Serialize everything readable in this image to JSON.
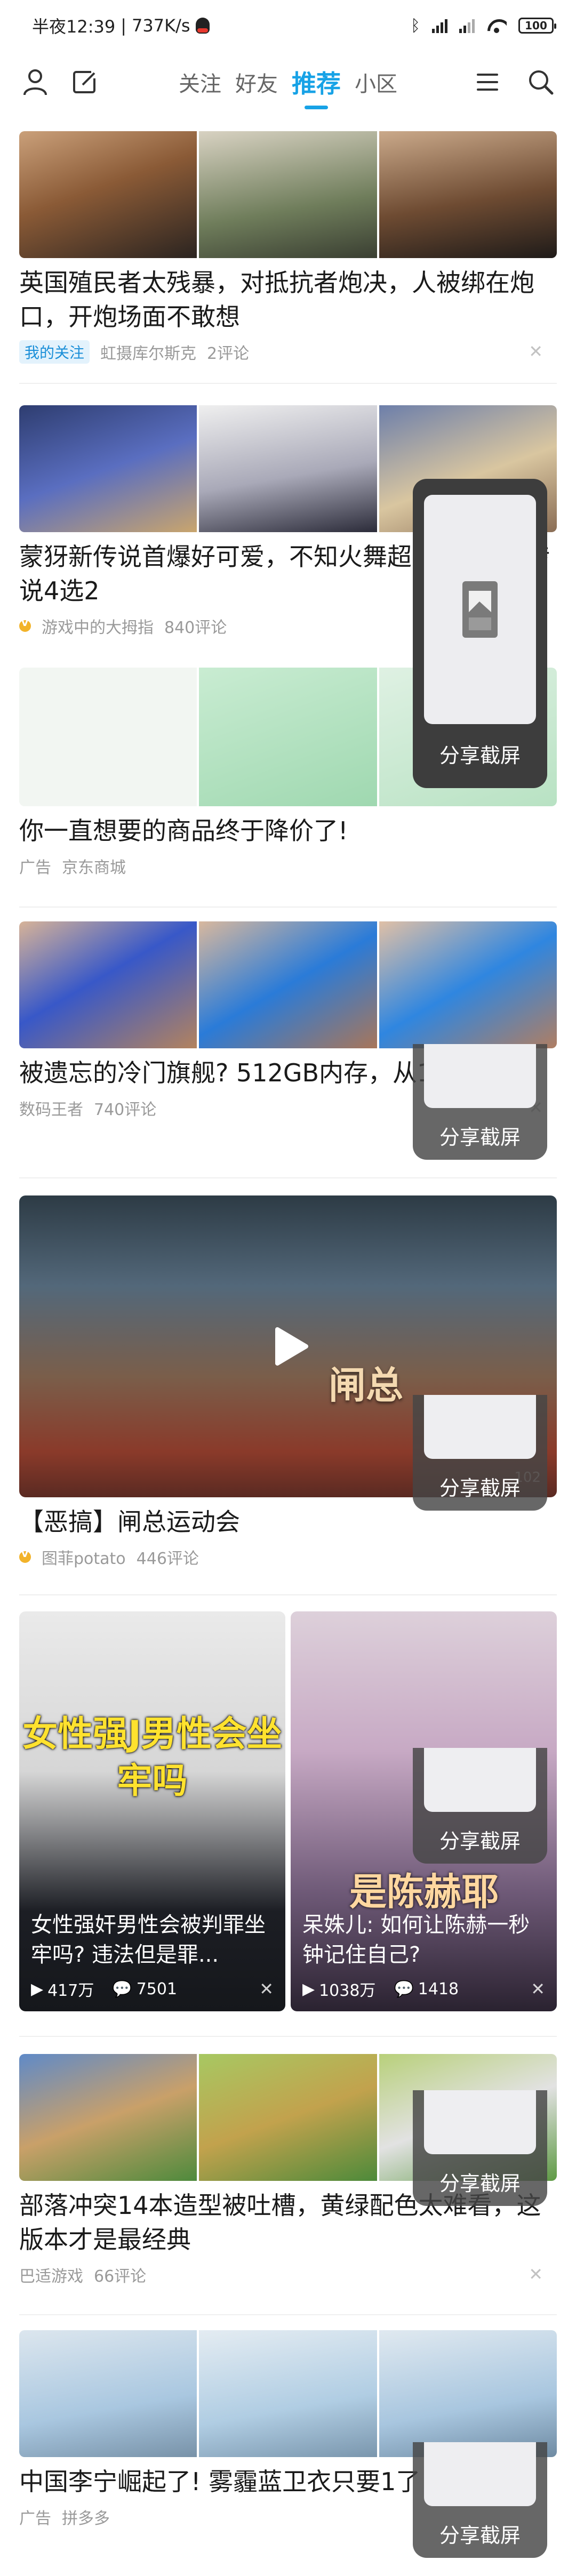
{
  "status_bar": {
    "time": "半夜12:39",
    "speed": "737K/s",
    "battery": "100"
  },
  "nav": {
    "tabs": [
      {
        "label": "关注"
      },
      {
        "label": "好友"
      },
      {
        "label": "推荐"
      },
      {
        "label": "小区"
      }
    ],
    "active_tab": "推荐"
  },
  "feed": [
    {
      "title": "英国殖民者太残暴，对抵抗者炮决，人被绑在炮口，开炮场面不敢想",
      "tag": "我的关注",
      "source": "虹摄库尔斯克",
      "comments": "2评论"
    },
    {
      "title": "蒙犽新传说首爆好可爱，不知火舞超选1，新星传说4选2",
      "source": "游戏中的大拇指",
      "comments": "840评论"
    },
    {
      "title": "你一直想要的商品终于降价了!",
      "ad": "广告",
      "source": "京东商城"
    },
    {
      "title": "被遗忘的冷门旗舰? 512GB内存，从1999",
      "source": "数码王者",
      "comments": "740评论"
    },
    {
      "title": "【恶搞】闸总运动会",
      "overlay_text": "闸总",
      "video_id": "102",
      "source": "图菲potato",
      "comments": "446评论"
    },
    {
      "cards": [
        {
          "big_text": "女性强J男性会坐牢吗",
          "caption": "女性强奸男性会被判罪坐牢吗? 违法但是罪...",
          "plays": "417万",
          "comments": "7501"
        },
        {
          "name_tag": "是陈赫耶",
          "caption": "呆姝儿: 如何让陈赫一秒钟记住自己?",
          "plays": "1038万",
          "comments": "1418"
        }
      ]
    },
    {
      "title": "部落冲突14本造型被吐槽，黄绿配色太难看，这版本才是最经典",
      "source": "巴适游戏",
      "comments": "66评论"
    },
    {
      "title": "中国李宁崛起了! 雾霾蓝卫衣只要1了!",
      "ad": "广告",
      "source": "拼多多"
    }
  ],
  "share": {
    "label": "分享截屏"
  }
}
